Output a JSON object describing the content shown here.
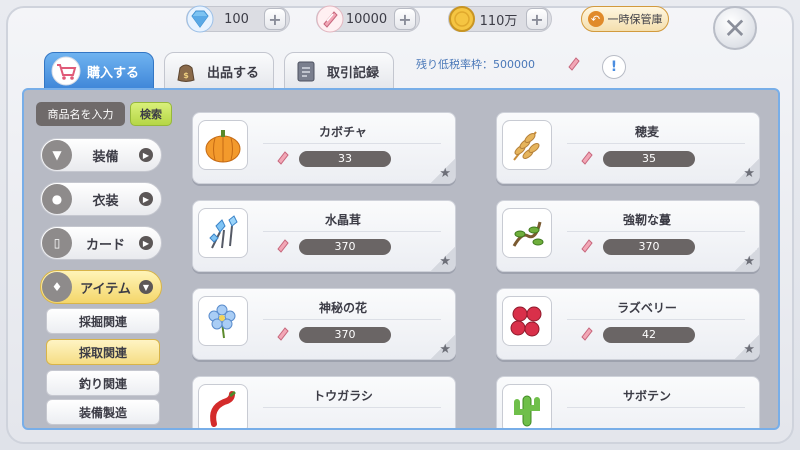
{
  "resources": [
    {
      "name": "diamond",
      "value": "100",
      "icon": "diamond-icon"
    },
    {
      "name": "ticket",
      "value": "10000",
      "icon": "ticket-icon"
    },
    {
      "name": "zeny",
      "value": "110万",
      "icon": "coin-icon"
    }
  ],
  "storage_button": "一時保管庫",
  "tabs": [
    {
      "label": "購入する",
      "icon": "cart-icon",
      "active": true
    },
    {
      "label": "出品する",
      "icon": "bag-icon",
      "active": false
    },
    {
      "label": "取引記録",
      "icon": "record-icon",
      "active": false
    }
  ],
  "tax_info": "残り低税率枠：500000",
  "info_button": "!",
  "search": {
    "placeholder": "商品名を入力",
    "button": "検索"
  },
  "categories": [
    {
      "label": "装備",
      "icon": "armor-icon"
    },
    {
      "label": "衣装",
      "icon": "costume-icon"
    },
    {
      "label": "カード",
      "icon": "card-icon"
    },
    {
      "label": "アイテム",
      "icon": "item-icon",
      "active": true
    }
  ],
  "subcategories": [
    {
      "label": "採掘関連"
    },
    {
      "label": "採取関連",
      "active": true
    },
    {
      "label": "釣り関連"
    },
    {
      "label": "装備製造"
    }
  ],
  "items": [
    {
      "name": "カボチャ",
      "price": "33",
      "icon": "pumpkin-icon"
    },
    {
      "name": "穂麦",
      "price": "35",
      "icon": "wheat-icon"
    },
    {
      "name": "水晶茸",
      "price": "370",
      "icon": "crystal-mushroom-icon"
    },
    {
      "name": "強靭な蔓",
      "price": "370",
      "icon": "vine-icon"
    },
    {
      "name": "神秘の花",
      "price": "370",
      "icon": "flower-icon"
    },
    {
      "name": "ラズベリー",
      "price": "42",
      "icon": "raspberry-icon"
    },
    {
      "name": "トウガラシ",
      "price": "",
      "icon": "pepper-icon"
    },
    {
      "name": "サボテン",
      "price": "",
      "icon": "cactus-icon"
    }
  ],
  "colors": {
    "accent_blue": "#3f86d8",
    "active_yellow": "#f4d66a",
    "price_bg": "#6a6565"
  }
}
